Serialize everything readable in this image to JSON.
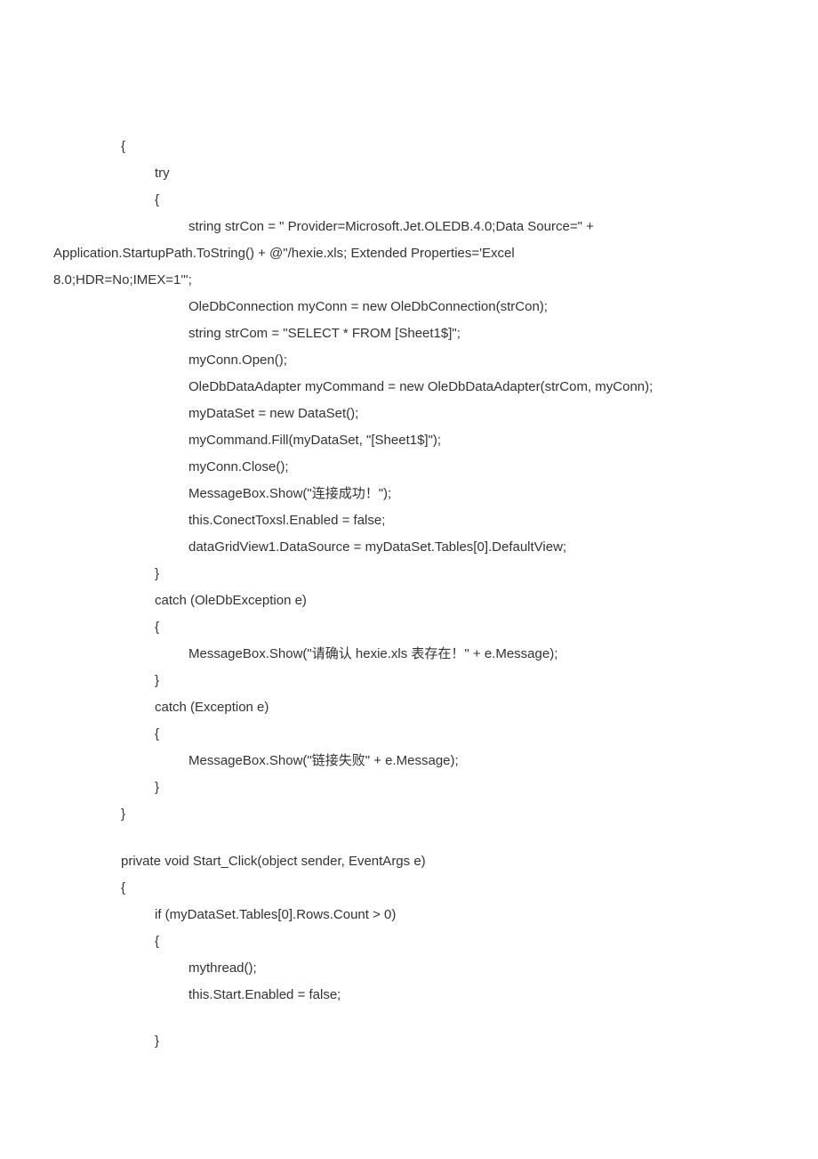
{
  "code": {
    "lines": [
      {
        "indent": 2,
        "text": "{"
      },
      {
        "indent": 3,
        "text": "try"
      },
      {
        "indent": 3,
        "text": "{"
      },
      {
        "indent": 4,
        "text_pre": "string strCon = \" Provider=Microsoft.Jet.OLEDB.4.0;Data Source=\" +",
        "wrap": []
      },
      {
        "indent": 0,
        "text": "Application.StartupPath.ToString() + @\"/hexie.xls; Extended Properties='Excel"
      },
      {
        "indent": 0,
        "text": "8.0;HDR=No;IMEX=1'\";"
      },
      {
        "indent": 4,
        "text": "OleDbConnection myConn = new OleDbConnection(strCon);"
      },
      {
        "indent": 4,
        "text": "string strCom = \"SELECT * FROM [Sheet1$]\";"
      },
      {
        "indent": 4,
        "text": "myConn.Open();"
      },
      {
        "indent": 4,
        "text": "OleDbDataAdapter myCommand = new OleDbDataAdapter(strCom, myConn);"
      },
      {
        "indent": 4,
        "text": "myDataSet = new DataSet();"
      },
      {
        "indent": 4,
        "text": "myCommand.Fill(myDataSet, \"[Sheet1$]\");"
      },
      {
        "indent": 4,
        "text": "myConn.Close();"
      },
      {
        "indent": 4,
        "text": "MessageBox.Show(\"连接成功！\");"
      },
      {
        "indent": 4,
        "text": "this.ConectToxsl.Enabled = false;"
      },
      {
        "indent": 4,
        "text": "dataGridView1.DataSource = myDataSet.Tables[0].DefaultView;"
      },
      {
        "indent": 3,
        "text": "}"
      },
      {
        "indent": 3,
        "text": "catch (OleDbException e)"
      },
      {
        "indent": 3,
        "text": "{"
      },
      {
        "indent": 4,
        "text": "MessageBox.Show(\"请确认 hexie.xls 表存在！\" + e.Message);"
      },
      {
        "indent": 3,
        "text": "}"
      },
      {
        "indent": 3,
        "text": "catch (Exception e)"
      },
      {
        "indent": 3,
        "text": "{"
      },
      {
        "indent": 4,
        "text": "MessageBox.Show(\"链接失败\" + e.Message);"
      },
      {
        "indent": 3,
        "text": "}"
      },
      {
        "indent": 2,
        "text": "}"
      },
      {
        "blank": true
      },
      {
        "indent": 2,
        "text": "private void Start_Click(object sender, EventArgs e)"
      },
      {
        "indent": 2,
        "text": "{"
      },
      {
        "indent": 3,
        "text": "if (myDataSet.Tables[0].Rows.Count > 0)"
      },
      {
        "indent": 3,
        "text": "{"
      },
      {
        "indent": 4,
        "text": "mythread();"
      },
      {
        "indent": 4,
        "text": "this.Start.Enabled = false;"
      },
      {
        "blank": true
      },
      {
        "indent": 3,
        "text": "}"
      }
    ]
  }
}
